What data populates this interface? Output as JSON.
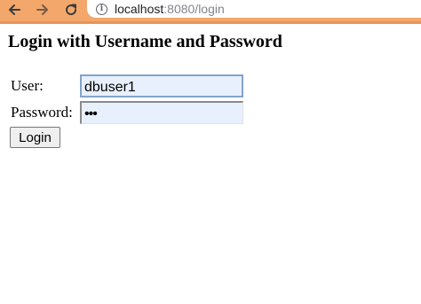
{
  "browser": {
    "url_host": "localhost",
    "url_rest": ":8080/login"
  },
  "page": {
    "heading": "Login with Username and Password"
  },
  "form": {
    "username_label": "User:",
    "username_value": "dbuser1",
    "password_label": "Password:",
    "password_masked": "•••",
    "submit_label": "Login"
  },
  "colors": {
    "toolbar": "#f3a76b",
    "autofill_background": "#e8f0fe"
  }
}
